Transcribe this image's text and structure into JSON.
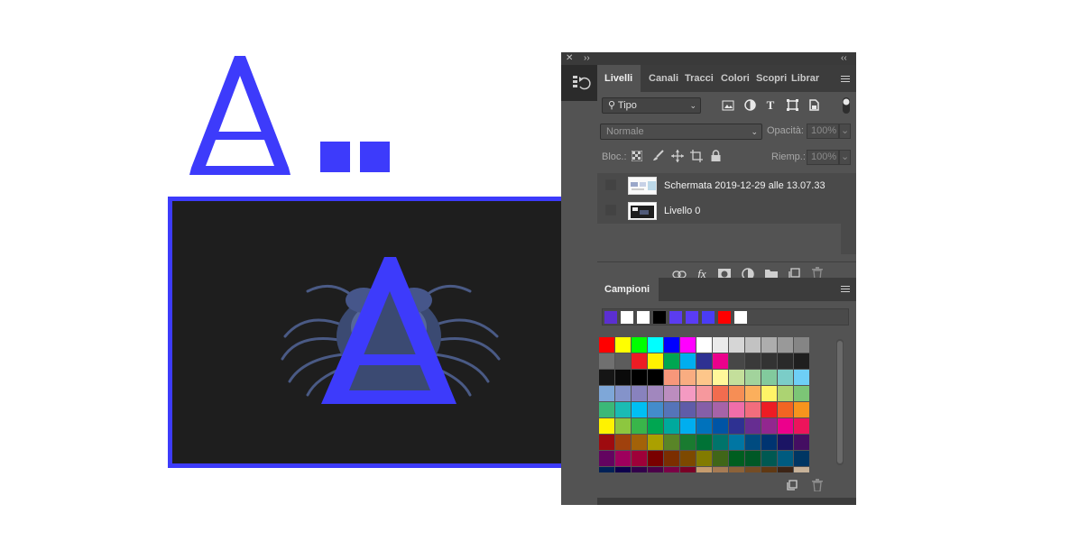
{
  "colors": {
    "brand_blue": "#3d3bfb",
    "artboard_bg": "#1e1e1e",
    "panel_bg": "#535353",
    "tab_bar_bg": "#3c3c3c"
  },
  "design": {
    "logo_icon": "a-letter-logo-icon",
    "artwork_icon": "crab-illustration-icon"
  },
  "panel": {
    "close_glyph": "✕",
    "collapse_glyph": "››",
    "expand_glyph": "‹‹",
    "layers": {
      "tabs": [
        {
          "label": "Livelli",
          "active": true
        },
        {
          "label": "Canali",
          "active": false
        },
        {
          "label": "Tracci",
          "active": false
        },
        {
          "label": "Colori",
          "active": false
        },
        {
          "label": "Scopri",
          "active": false
        },
        {
          "label": "Librar",
          "active": false
        }
      ],
      "filter": {
        "value": "Tipo",
        "icon": "search-icon"
      },
      "filter_icons": [
        "image-filter-icon",
        "adjustment-filter-icon",
        "type-filter-icon",
        "shape-filter-icon",
        "smart-object-filter-icon"
      ],
      "blend_mode": "Normale",
      "opacity_label": "Opacità:",
      "opacity_value": "100%",
      "lock_label": "Bloc.:",
      "lock_icons": [
        "lock-transparency-icon",
        "lock-pixels-icon",
        "lock-position-icon",
        "lock-artboard-icon",
        "lock-all-icon"
      ],
      "fill_label": "Riemp.:",
      "fill_value": "100%",
      "layers_list": [
        {
          "name": "Schermata 2019-12-29 alle 13.07.33"
        },
        {
          "name": "Livello 0"
        }
      ],
      "footer_icons": [
        "link-icon",
        "fx-icon",
        "mask-icon",
        "adjustment-icon",
        "folder-icon",
        "new-layer-icon",
        "trash-icon"
      ]
    },
    "swatches": {
      "tab": "Campioni",
      "recent": [
        "#5b2fd1",
        "#ffffff",
        "#ffffff",
        "#000000",
        "#5b3cf0",
        "#5a3cf5",
        "#4a3cf5",
        "#ff0000",
        "#ffffff"
      ],
      "grid": [
        [
          "#ff0000",
          "#ffff00",
          "#00ff00",
          "#00ffff",
          "#0000ff",
          "#ff00ff",
          "#ffffff",
          "#ebebeb",
          "#d6d6d6",
          "#c2c2c2",
          "#adadad",
          "#999999",
          "#858585"
        ],
        [
          "#707070",
          "#5c5c5c",
          "#ed1c24",
          "#fff200",
          "#00a651",
          "#00aeef",
          "#2e3192",
          "#ec008c",
          "#474747",
          "#3a3a3a",
          "#333333",
          "#2a2a2a",
          "#1f1f1f"
        ],
        [
          "#151515",
          "#0a0a0a",
          "#000000",
          "#000000",
          "#f7977a",
          "#f9ad81",
          "#fdc68a",
          "#fff79a",
          "#c4df9b",
          "#a2d39c",
          "#82ca9d",
          "#7bcdc8",
          "#6ecff6"
        ],
        [
          "#7ea7d8",
          "#8493ca",
          "#8882be",
          "#a187be",
          "#bc8dbf",
          "#f49ac2",
          "#f6989d",
          "#f26c4f",
          "#f68e55",
          "#fbaf5c",
          "#fff467",
          "#acd372",
          "#7cc576"
        ],
        [
          "#3bb878",
          "#1abbb4",
          "#00bff3",
          "#438ccb",
          "#5574b9",
          "#605ca8",
          "#855fa8",
          "#a763a8",
          "#f06ea9",
          "#f26d7d",
          "#ed1c24",
          "#f26522",
          "#f7941d"
        ],
        [
          "#fff200",
          "#8dc73f",
          "#39b54a",
          "#00a651",
          "#00a99d",
          "#00aeef",
          "#0072bc",
          "#0054a5",
          "#2e3192",
          "#662d91",
          "#92278f",
          "#ec008c",
          "#ed145b"
        ],
        [
          "#9e0b0f",
          "#a0410d",
          "#a36209",
          "#aba000",
          "#598527",
          "#1a7b30",
          "#007236",
          "#00746b",
          "#0076a3",
          "#004b80",
          "#003471",
          "#1b1464",
          "#440e62"
        ],
        [
          "#630460",
          "#9e005d",
          "#9e0039",
          "#790000",
          "#7b2e00",
          "#7d4900",
          "#827b00",
          "#406618",
          "#005e20",
          "#005826",
          "#005952",
          "#005b7f",
          "#003663"
        ],
        [
          "#002157",
          "#0d004c",
          "#32004b",
          "#4b0049",
          "#7b0046",
          "#7a0026",
          "#c69c6e",
          "#a77b54",
          "#8c6239",
          "#754c24",
          "#603913",
          "#3c2415",
          "#c7b299"
        ]
      ],
      "footer_icons": [
        "new-swatch-icon",
        "trash-icon"
      ]
    }
  }
}
